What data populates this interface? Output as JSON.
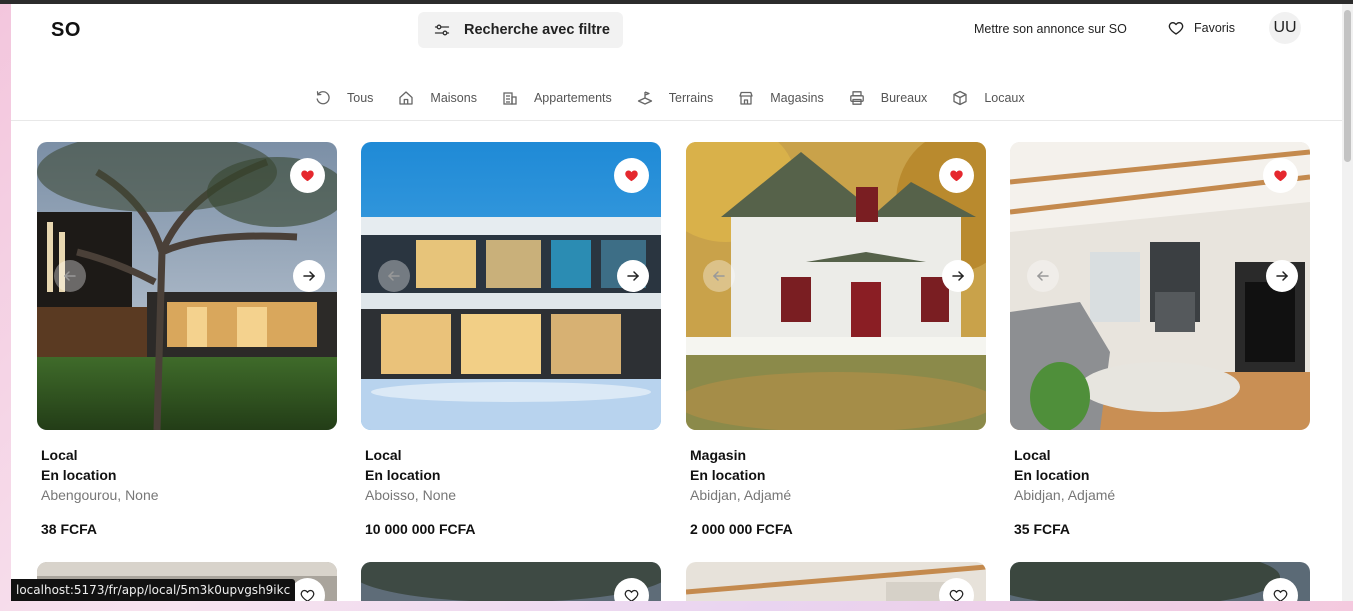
{
  "header": {
    "logo": "SO",
    "search_label": "Recherche avec filtre",
    "publish_label": "Mettre son annonce sur SO",
    "favorites_label": "Favoris",
    "avatar_initials": "UU"
  },
  "categories": [
    {
      "label": "Tous",
      "icon": "refresh-icon"
    },
    {
      "label": "Maisons",
      "icon": "house-icon"
    },
    {
      "label": "Appartements",
      "icon": "building-icon"
    },
    {
      "label": "Terrains",
      "icon": "land-icon"
    },
    {
      "label": "Magasins",
      "icon": "store-icon"
    },
    {
      "label": "Bureaux",
      "icon": "printer-icon"
    },
    {
      "label": "Locaux",
      "icon": "box-icon"
    }
  ],
  "listings": [
    {
      "type": "Local",
      "status": "En location",
      "location": "Abengourou, None",
      "price": "38 FCFA",
      "favorited": true
    },
    {
      "type": "Local",
      "status": "En location",
      "location": "Aboisso, None",
      "price": "10 000 000 FCFA",
      "favorited": true
    },
    {
      "type": "Magasin",
      "status": "En location",
      "location": "Abidjan, Adjamé",
      "price": "2 000 000 FCFA",
      "favorited": true
    },
    {
      "type": "Local",
      "status": "En location",
      "location": "Abidjan, Adjamé",
      "price": "35 FCFA",
      "favorited": true
    }
  ],
  "statusbar_url": "localhost:5173/fr/app/local/5m3k0upvgsh9ikc",
  "colors": {
    "heart": "#e5282e",
    "accent": "#111111"
  }
}
